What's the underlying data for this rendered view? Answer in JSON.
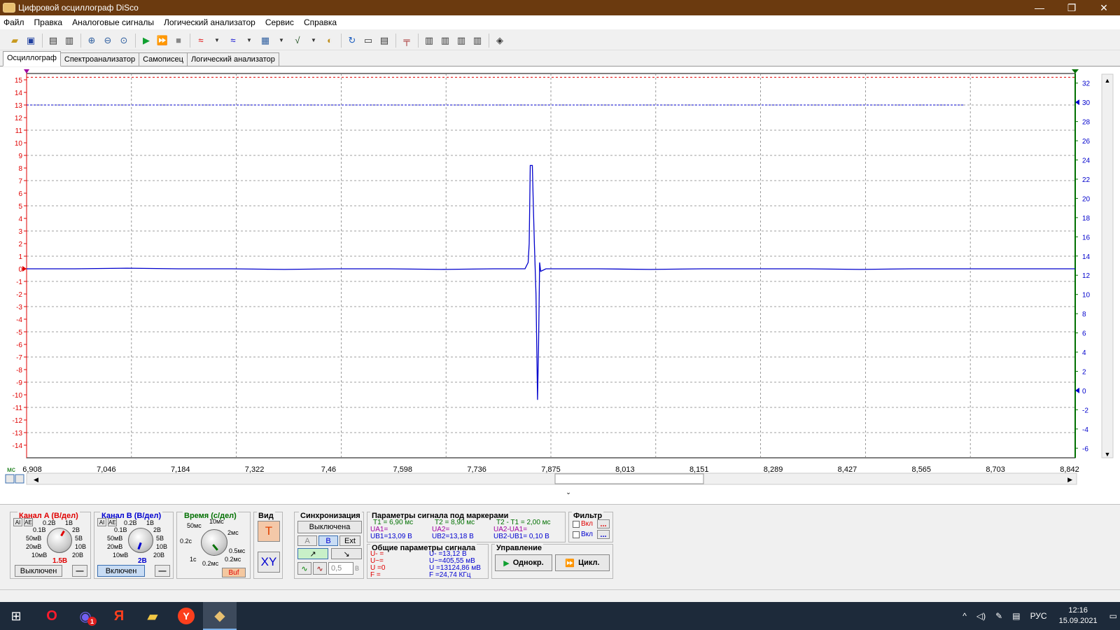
{
  "window": {
    "title": "Цифровой осциллограф DiSco",
    "min": "—",
    "max": "❐",
    "close": "✕"
  },
  "menu": [
    "Файл",
    "Правка",
    "Аналоговые сигналы",
    "Логический анализатор",
    "Сервис",
    "Справка"
  ],
  "tabs": [
    "Осциллограф",
    "Спектроанализатор",
    "Самописец",
    "Логический анализатор"
  ],
  "scope": {
    "x_unit": "мс",
    "x_ticks": [
      "6,908",
      "7,046",
      "7,184",
      "7,322",
      "7,46",
      "7,598",
      "7,736",
      "7,875",
      "8,013",
      "8,151",
      "8,289",
      "8,427",
      "8,565",
      "8,703",
      "8,842"
    ],
    "left_ticks": [
      "15",
      "14",
      "13",
      "12",
      "11",
      "10",
      "9",
      "8",
      "7",
      "6",
      "5",
      "4",
      "3",
      "2",
      "1",
      "0",
      "-1",
      "-2",
      "-3",
      "-4",
      "-5",
      "-6",
      "-7",
      "-8",
      "-9",
      "-10",
      "-11",
      "-12",
      "-13",
      "-14"
    ],
    "right_ticks": [
      "32",
      "30",
      "28",
      "26",
      "24",
      "22",
      "20",
      "18",
      "16",
      "14",
      "12",
      "10",
      "8",
      "6",
      "4",
      "2",
      "0",
      "-2",
      "-4",
      "-6"
    ],
    "colors": {
      "channel_a": "#e00000",
      "channel_b": "#0000cc",
      "right_axis": "#007000",
      "grid": "#808080"
    }
  },
  "chart_data": {
    "type": "line",
    "xlabel": "мс",
    "xlim": [
      6.908,
      8.911
    ],
    "ylim_left": [
      -15,
      15.5
    ],
    "ylim_right": [
      -7,
      33
    ],
    "series": [
      {
        "channel": "B",
        "x": [
          6.908,
          7.0,
          7.1,
          7.2,
          7.3,
          7.4,
          7.5,
          7.6,
          7.7,
          7.8,
          7.86,
          7.866,
          7.868,
          7.87,
          7.872,
          7.874,
          7.876,
          7.878,
          7.881,
          7.884,
          7.886,
          7.888,
          7.89,
          7.9,
          8.0,
          8.1,
          8.2,
          8.3,
          8.4,
          8.5,
          8.6,
          8.7,
          8.8,
          8.911
        ],
        "y": [
          0.0,
          0.0,
          0.05,
          0.0,
          0.0,
          -0.05,
          0.0,
          0.0,
          -0.05,
          0.0,
          0.0,
          0.5,
          2.0,
          8.2,
          8.2,
          8.2,
          5.0,
          2.0,
          -2.0,
          -10.4,
          -6.0,
          0.5,
          -0.2,
          0.0,
          0.0,
          -0.05,
          0.0,
          0.0,
          0.0,
          -0.05,
          0.0,
          0.0,
          0.0,
          0.0
        ]
      }
    ]
  },
  "channel_a": {
    "title": "Канал A (В/дел)",
    "mode1": "AI",
    "mode2": "AE",
    "scale": [
      "0.2В",
      "1В",
      "0.1В",
      "2В",
      "50мВ",
      "5В",
      "20мВ",
      "10В",
      "10мВ",
      "20В"
    ],
    "value": "1.5В",
    "state": "Выключен",
    "minus": "—"
  },
  "channel_b": {
    "title": "Канал B (В/дел)",
    "mode1": "AI",
    "mode2": "AE",
    "scale": [
      "0.2В",
      "1В",
      "0.1В",
      "2В",
      "50мВ",
      "5В",
      "20мВ",
      "10В",
      "10мВ",
      "20В"
    ],
    "value": "2В",
    "state": "Включен",
    "minus": "—"
  },
  "time": {
    "title": "Время (с/дел)",
    "scale": [
      "10мс",
      "50мс",
      "2мс",
      "0.2с",
      "0.5мс",
      "1с",
      "0.2мс"
    ],
    "buf": "Buf"
  },
  "view": {
    "title": "Вид",
    "t": "T",
    "xy": "XY"
  },
  "sync": {
    "title": "Синхронизация",
    "state": "Выключена",
    "a": "A",
    "b": "B",
    "ext": "Ext",
    "level": "0,5",
    "unit": "В"
  },
  "params": {
    "title": "Параметры сигнала под маркерами",
    "t1": "T1 = 6,90 мс",
    "t2": "T2 = 8,90 мс",
    "dt": "T2 - T1 = 2,00 мс",
    "ua1": "UA1=",
    "ua2": "UA2=",
    "dua": "UA2-UA1=",
    "ub1": "UB1=13,09 В",
    "ub2": "UB2=13,18 В",
    "dub": "UB2-UB1= 0,10 В"
  },
  "general": {
    "title": "Общие параметры сигнала",
    "a_umin": "U- =",
    "a_uac": "U~=",
    "a_u": "U =0",
    "a_f": "F =",
    "b_umin": "U- =13,12 В",
    "b_uac": "U~=405,55 мВ",
    "b_u": "U =13124,86 мВ",
    "b_f": "F =24,74 КГц"
  },
  "filter": {
    "title": "Фильтр",
    "on1": "Вкл",
    "on2": "Вкл",
    "dots": "..."
  },
  "control": {
    "title": "Управление",
    "single": "Однокр.",
    "cycle": "Цикл."
  },
  "taskbar": {
    "lang": "РУС",
    "time": "12:16",
    "date": "15.09.2021",
    "badge": "1"
  }
}
